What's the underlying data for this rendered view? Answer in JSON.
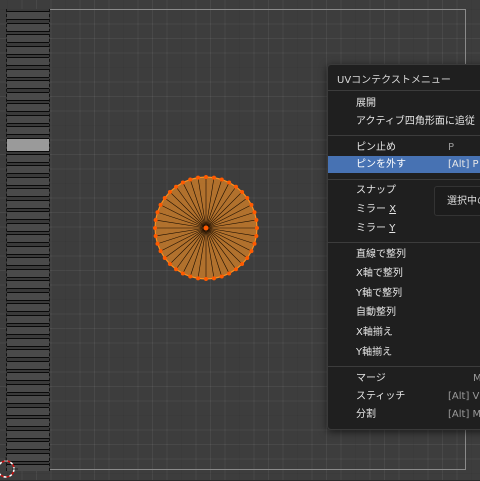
{
  "menu": {
    "title": "UVコンテクストメニュー",
    "items": [
      {
        "label": "展開",
        "shortcut": ""
      },
      {
        "label": "アクティブ四角形面に追従",
        "shortcut": ""
      },
      {
        "label": "ピン止め",
        "shortcut": "P"
      },
      {
        "label": "ピンを外す",
        "shortcut": "[Alt] P"
      },
      {
        "label": "スナップ",
        "shortcut": ""
      },
      {
        "label": "ミラー X",
        "label_main": "ミラー ",
        "label_key": "X",
        "shortcut": ""
      },
      {
        "label": "ミラー Y",
        "label_main": "ミラー ",
        "label_key": "Y",
        "shortcut": ""
      },
      {
        "label": "直線で整列",
        "shortcut": ""
      },
      {
        "label": "X軸で整列",
        "shortcut": ""
      },
      {
        "label": "Y軸で整列",
        "shortcut": ""
      },
      {
        "label": "自動整列",
        "shortcut": ""
      },
      {
        "label": "X軸揃え",
        "shortcut": ""
      },
      {
        "label": "Y軸揃え",
        "shortcut": ""
      },
      {
        "label": "マージ",
        "shortcut": "M"
      },
      {
        "label": "スティッチ",
        "shortcut": "[Alt] V"
      },
      {
        "label": "分割",
        "shortcut": "[Alt] M"
      }
    ],
    "highlighted_index": 3
  },
  "tooltip": {
    "text": "選択中の"
  },
  "colors": {
    "accent": "#4772b3",
    "uv_fill": "#c67a2a",
    "uv_edge": "#ff8c1a",
    "vertex": "#ff5a00"
  }
}
